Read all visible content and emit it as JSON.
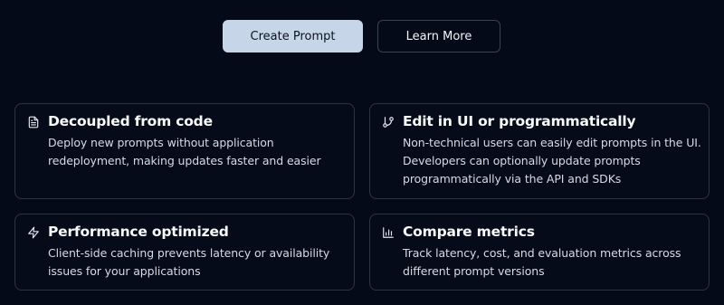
{
  "actions": {
    "primary_label": "Create Prompt",
    "secondary_label": "Learn More"
  },
  "features": [
    {
      "icon": "file-text-icon",
      "title": "Decoupled from code",
      "lines": [
        "Deploy new prompts without application",
        "redeployment, making updates faster and easier"
      ]
    },
    {
      "icon": "git-branch-icon",
      "title": "Edit in UI or programmatically",
      "lines": [
        "Non-technical users can easily edit prompts in the UI.",
        "Developers can optionally update prompts",
        "programmatically via the API and SDKs"
      ]
    },
    {
      "icon": "zap-icon",
      "title": "Performance optimized",
      "lines": [
        "Client-side caching prevents latency or availability",
        "issues for your applications"
      ]
    },
    {
      "icon": "bar-chart-icon",
      "title": "Compare metrics",
      "lines": [
        "Track latency, cost, and evaluation metrics across",
        "different prompt versions"
      ]
    }
  ]
}
